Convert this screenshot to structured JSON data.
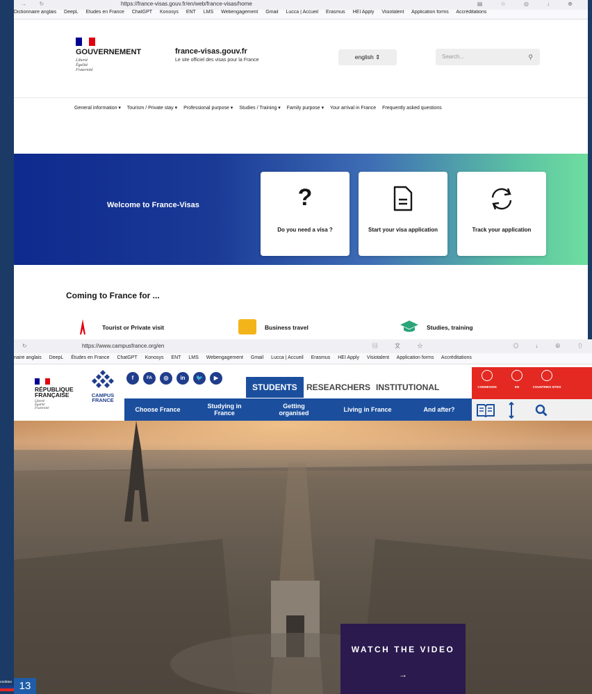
{
  "top_browser": {
    "url": "https://france-visas.gouv.fr/en/web/france-visas/home",
    "bookmarks": [
      "Dictionnaire anglais",
      "DeepL",
      "Études en France",
      "ChatGPT",
      "Konosys",
      "ENT",
      "LMS",
      "Webengagement",
      "Gmail",
      "Lucca | Accueil",
      "Erasmus",
      "HEI Apply",
      "Visiotalent",
      "Application forms",
      "Accréditations"
    ]
  },
  "france_visas": {
    "gov_label": "GOUVERNEMENT",
    "motto": [
      "Liberté",
      "Égalité",
      "Fraternité"
    ],
    "site_name": "france-visas.gouv.fr",
    "site_tagline": "Le site officiel des visas pour la France",
    "language": "english",
    "search_placeholder": "Search...",
    "nav": [
      "General information ▾",
      "Tourism / Private stay ▾",
      "Professional purpose ▾",
      "Studies / Training ▾",
      "Family purpose ▾",
      "Your arrival in France",
      "Frequently asked questions"
    ],
    "hero_title": "Welcome to France-Visas",
    "cards": [
      "Do you need a visa ?",
      "Start your visa application",
      "Track your application"
    ],
    "coming_title": "Coming to France for ...",
    "categories": [
      "Tourist or Private visit",
      "Business travel",
      "Studies, training"
    ]
  },
  "bottom_browser": {
    "url": "https://www.campusfrance.org/en",
    "bookmarks": [
      "naire anglais",
      "DeepL",
      "Études en France",
      "ChatGPT",
      "Konosys",
      "ENT",
      "LMS",
      "Webengagement",
      "Gmail",
      "Lucca | Accueil",
      "Erasmus",
      "HEI Apply",
      "Visiotalent",
      "Application forms",
      "Accréditations"
    ]
  },
  "campus_france": {
    "republic_label": "RÉPUBLIQUE FRANÇAISE",
    "motto": [
      "Liberté",
      "Égalité",
      "Fraternité"
    ],
    "logo_text": "CAMPUS FRANCE",
    "social": [
      "f",
      "FA",
      "◎",
      "in",
      "🐦",
      "▶"
    ],
    "audience_tabs": [
      "STUDENTS",
      "RESEARCHERS",
      "INSTITUTIONAL"
    ],
    "menu": [
      "Choose France",
      "Studying in France",
      "Getting organised",
      "Living in France",
      "And after?"
    ],
    "utility": [
      "CONNEXION",
      "EN",
      "COUNTRIES SITES"
    ],
    "watch_label": "WATCH THE VIDEO",
    "watch_arrow": "→"
  },
  "slide": {
    "cookies_label": "cookies",
    "page_number": "13"
  },
  "colors": {
    "cf_blue": "#1b4f9e",
    "cf_red": "#e32922",
    "fv_hero_start": "#0e2a8e",
    "fv_hero_end": "#6ede9f"
  }
}
